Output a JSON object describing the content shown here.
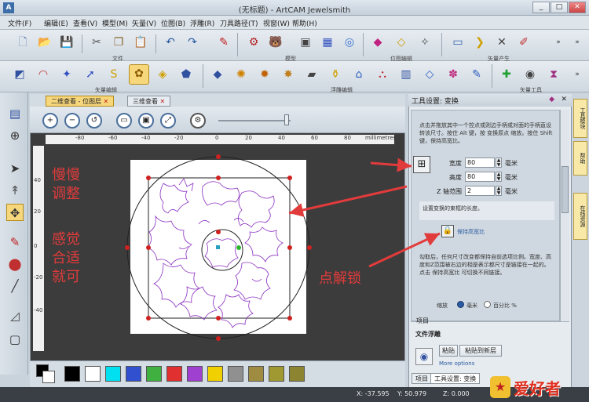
{
  "window": {
    "title": "(无标题) - ArtCAM Jewelsmith",
    "app_icon": "A",
    "min": "_",
    "max": "□",
    "close": "✕"
  },
  "menu": [
    "文件(F)",
    "编辑(E)",
    "查看(V)",
    "模型(M)",
    "矢量(V)",
    "位图(B)",
    "浮雕(R)",
    "刀具路径(T)",
    "视窗(W)",
    "帮助(H)"
  ],
  "toolbar_groups_row1": [
    "文件",
    "模型",
    "位图编辑",
    "矢量产生"
  ],
  "toolbar_groups_row2": [
    "矢量编辑",
    "浮雕编辑",
    "矢量工具"
  ],
  "view_tabs": {
    "tab1": "二维查看 - 位图层",
    "tab1_close": "✕",
    "tab2": "三维查看",
    "tab2_close": "✕"
  },
  "ruler": {
    "unit": "millimetres",
    "top_ticks": [
      "-80",
      "-60",
      "-40",
      "-20",
      "0",
      "20",
      "40",
      "60",
      "80"
    ],
    "left_ticks": [
      "40",
      "20",
      "0",
      "-20",
      "-40"
    ]
  },
  "annotations": {
    "left1": "慢慢",
    "left2": "调整",
    "left3": "感觉",
    "left4": "合适",
    "left5": "就可",
    "right": "点解锁"
  },
  "palette_colors": [
    "#000000",
    "#ffffff",
    "#00e0f0",
    "#3050d0",
    "#40b040",
    "#e03030",
    "#a040d0",
    "#f0d000",
    "#909090",
    "#a08c40",
    "#a09830",
    "#8c8430"
  ],
  "status": {
    "x": "X: -37.595",
    "y": "Y: 50.979",
    "z": "Z: 0.000"
  },
  "tool_panel": {
    "title": "工具设置: 变换",
    "pin": "◆",
    "close": "✕",
    "intro": "点击并拖放其中一个控点或则边手柄或对面的手柄直设转该尺寸。按住 Alt 键，按 变换原点 缩放。按住 Shift键，保持高宽比。",
    "width_label": "宽度",
    "width_value": "80",
    "height_label": "高度",
    "height_value": "80",
    "z_label": "Z 轴范围",
    "z_value": "2",
    "unit": "毫米",
    "box_hint": "设置变换的束框的长度。",
    "lock_label": "保持高宽比",
    "help_text": "勾取后，任何尺寸改变都保持自前选项比例。宽度、高度和Z范围被右边的相是表示都尺寸是链接在一起的。点击 保持高宽比 可切换不同链接。",
    "scale_label": "缩放",
    "radio_mm": "毫米",
    "radio_pct": "百分比 %",
    "item_label": "项目",
    "relief_header": "文件浮雕",
    "paste_btn": "粘贴",
    "paste_new_btn": "粘贴到新层",
    "more_options": "More options"
  },
  "bottom_tabs": [
    "项目",
    "工具设置: 变换"
  ],
  "right_strip_tabs": [
    "工具模块",
    "帮助",
    "在线资源"
  ],
  "watermark": "爱好者"
}
